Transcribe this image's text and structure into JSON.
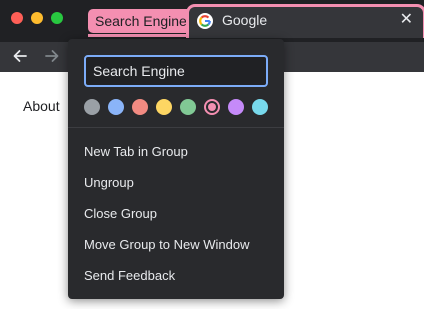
{
  "tab_group": {
    "label": "Search Engine",
    "color": "#f48fb1"
  },
  "tab": {
    "title": "Google",
    "close_symbol": "✕"
  },
  "page": {
    "about_link": "About"
  },
  "menu": {
    "group_name_value": "Search Engine",
    "colors": [
      {
        "name": "grey",
        "hex": "#9aa0a6",
        "selected": false
      },
      {
        "name": "blue",
        "hex": "#8ab4f8",
        "selected": false
      },
      {
        "name": "red",
        "hex": "#f28b82",
        "selected": false
      },
      {
        "name": "yellow",
        "hex": "#fdd663",
        "selected": false
      },
      {
        "name": "green",
        "hex": "#81c995",
        "selected": false
      },
      {
        "name": "pink",
        "hex": "#f48fb1",
        "selected": true
      },
      {
        "name": "purple",
        "hex": "#c58af9",
        "selected": false
      },
      {
        "name": "cyan",
        "hex": "#78d9ec",
        "selected": false
      }
    ],
    "items": [
      "New Tab in Group",
      "Ungroup",
      "Close Group",
      "Move Group to New Window",
      "Send Feedback"
    ]
  }
}
